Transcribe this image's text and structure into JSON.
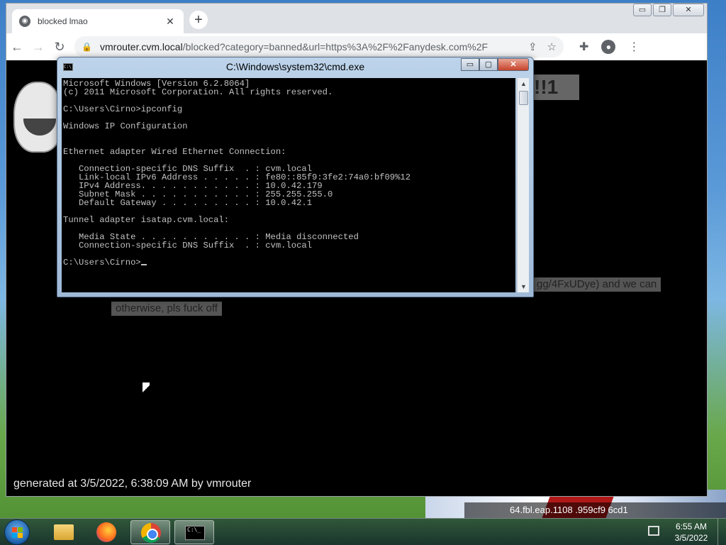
{
  "browser": {
    "tab_title": "blocked lmao",
    "tab_close": "✕",
    "new_tab": "+",
    "url_host": "vmrouter.cvm.local",
    "url_rest": "/blocked?category=banned&url=https%3A%2F%2Fanydesk.com%2F",
    "window_buttons": {
      "minimize": "▭",
      "maximize": "❐",
      "close": "✕"
    }
  },
  "page": {
    "heading_fragment": "!!1",
    "line_fragment_1": "gg/4FxUDye) and we can",
    "line_fragment_2": "otherwise, pls fuck off",
    "footer": "generated at 3/5/2022, 6:38:09 AM by vmrouter"
  },
  "cmd": {
    "title": "C:\\Windows\\system32\\cmd.exe",
    "icon_text": "C:\\",
    "buttons": {
      "minimize": "▭",
      "maximize": "▢",
      "close": "✕"
    },
    "output": "Microsoft Windows [Version 6.2.8064]\n(c) 2011 Microsoft Corporation. All rights reserved.\n\nC:\\Users\\Cirno>ipconfig\n\nWindows IP Configuration\n\n\nEthernet adapter Wired Ethernet Connection:\n\n   Connection-specific DNS Suffix  . : cvm.local\n   Link-local IPv6 Address . . . . . : fe80::85f9:3fe2:74a0:bf09%12\n   IPv4 Address. . . . . . . . . . . : 10.0.42.179\n   Subnet Mask . . . . . . . . . . . : 255.255.255.0\n   Default Gateway . . . . . . . . . : 10.0.42.1\n\nTunnel adapter isatap.cvm.local:\n\n   Media State . . . . . . . . . . . : Media disconnected\n   Connection-specific DNS Suffix  . : cvm.local\n\nC:\\Users\\Cirno>"
  },
  "desktop": {
    "background_strip_text": "64.fbl.eap.1108 .959cf9 6cd1"
  },
  "taskbar": {
    "clock_time": "6:55 AM",
    "clock_date": "3/5/2022",
    "cmd_icon_text": "C:\\_"
  }
}
